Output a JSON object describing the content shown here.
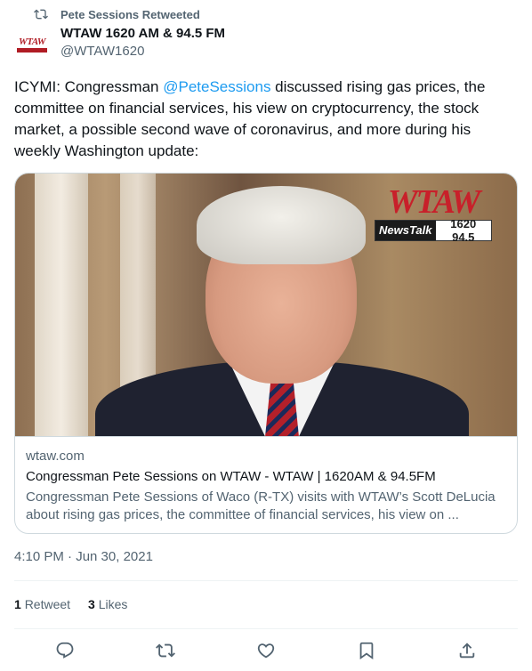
{
  "retweet": {
    "icon": "retweet-icon",
    "text": "Pete Sessions Retweeted"
  },
  "author": {
    "avatar_text": "WTAW",
    "display_name": "WTAW 1620 AM & 94.5 FM",
    "handle": "@WTAW1620"
  },
  "tweet": {
    "text_before": "ICYMI: Congressman ",
    "mention": "@PeteSessions",
    "text_after": " discussed rising gas prices, the committee on financial services, his view on cryptocurrency, the stock market, a possible second wave of coronavirus, and more during his weekly Washington update:"
  },
  "card": {
    "logo_word": "WTAW",
    "logo_news": "NewsTalk",
    "logo_freq": "1620 94.5",
    "domain": "wtaw.com",
    "title": "Congressman Pete Sessions on WTAW - WTAW | 1620AM & 94.5FM",
    "description": "Congressman Pete Sessions of Waco (R-TX) visits with WTAW’s Scott DeLucia about rising gas prices, the committee of financial services, his view on ..."
  },
  "timestamp": "4:10 PM · Jun 30, 2021",
  "stats": {
    "retweet_count": "1",
    "retweet_label": "Retweet",
    "like_count": "3",
    "like_label": "Likes"
  },
  "actions": [
    "reply-icon",
    "retweet-icon",
    "like-icon",
    "bookmark-icon",
    "share-icon"
  ],
  "colors": {
    "accent": "#1d9bf0",
    "text": "#0f1419",
    "secondary": "#536471",
    "brand": "#c8202a"
  }
}
